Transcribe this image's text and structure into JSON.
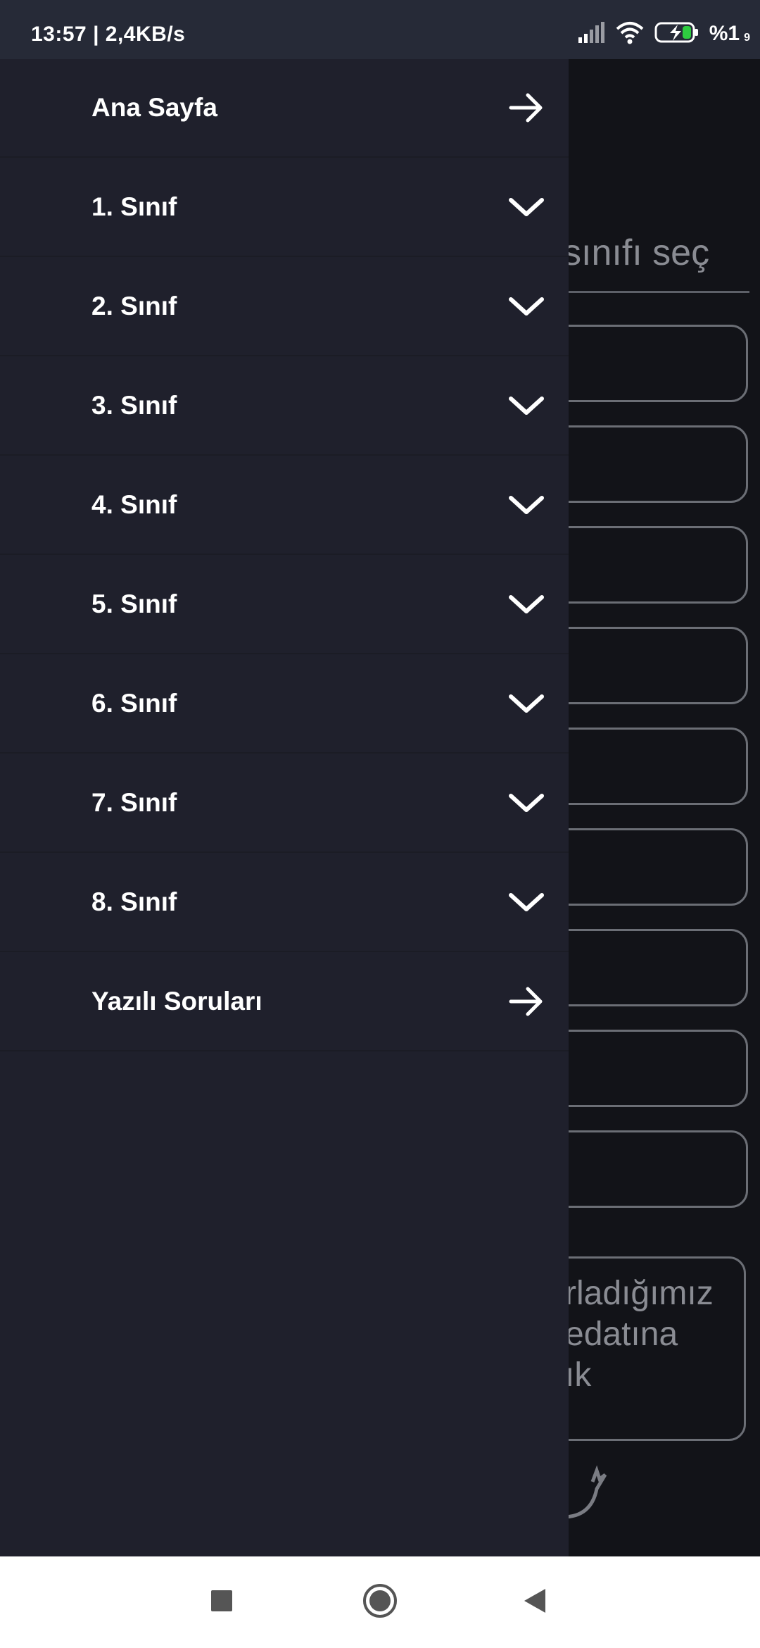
{
  "status_bar": {
    "time_speed": "13:57 | 2,4KB/s",
    "battery_text": "%1",
    "battery_sub": "9",
    "icons": [
      "signal-icon",
      "wifi-icon",
      "battery-charging-icon"
    ]
  },
  "background": {
    "heading": "sınıfı seç",
    "note_lines": [
      "rladığımız",
      "edatına",
      "ık"
    ]
  },
  "drawer": {
    "items": [
      {
        "label": "Ana Sayfa",
        "icon": "arrow-right-icon"
      },
      {
        "label": "1. Sınıf",
        "icon": "chevron-down-icon"
      },
      {
        "label": "2. Sınıf",
        "icon": "chevron-down-icon"
      },
      {
        "label": "3. Sınıf",
        "icon": "chevron-down-icon"
      },
      {
        "label": "4. Sınıf",
        "icon": "chevron-down-icon"
      },
      {
        "label": "5. Sınıf",
        "icon": "chevron-down-icon"
      },
      {
        "label": "6. Sınıf",
        "icon": "chevron-down-icon"
      },
      {
        "label": "7. Sınıf",
        "icon": "chevron-down-icon"
      },
      {
        "label": "8. Sınıf",
        "icon": "chevron-down-icon"
      },
      {
        "label": "Yazılı Soruları",
        "icon": "arrow-right-icon"
      }
    ]
  },
  "navigation_bar": {
    "buttons": [
      "recents-square-icon",
      "home-circle-icon",
      "back-triangle-icon"
    ]
  },
  "colors": {
    "drawer_bg": "#1f202c",
    "status_bar_bg": "#262a37",
    "app_bg": "#121318",
    "text": "#ffffff"
  }
}
